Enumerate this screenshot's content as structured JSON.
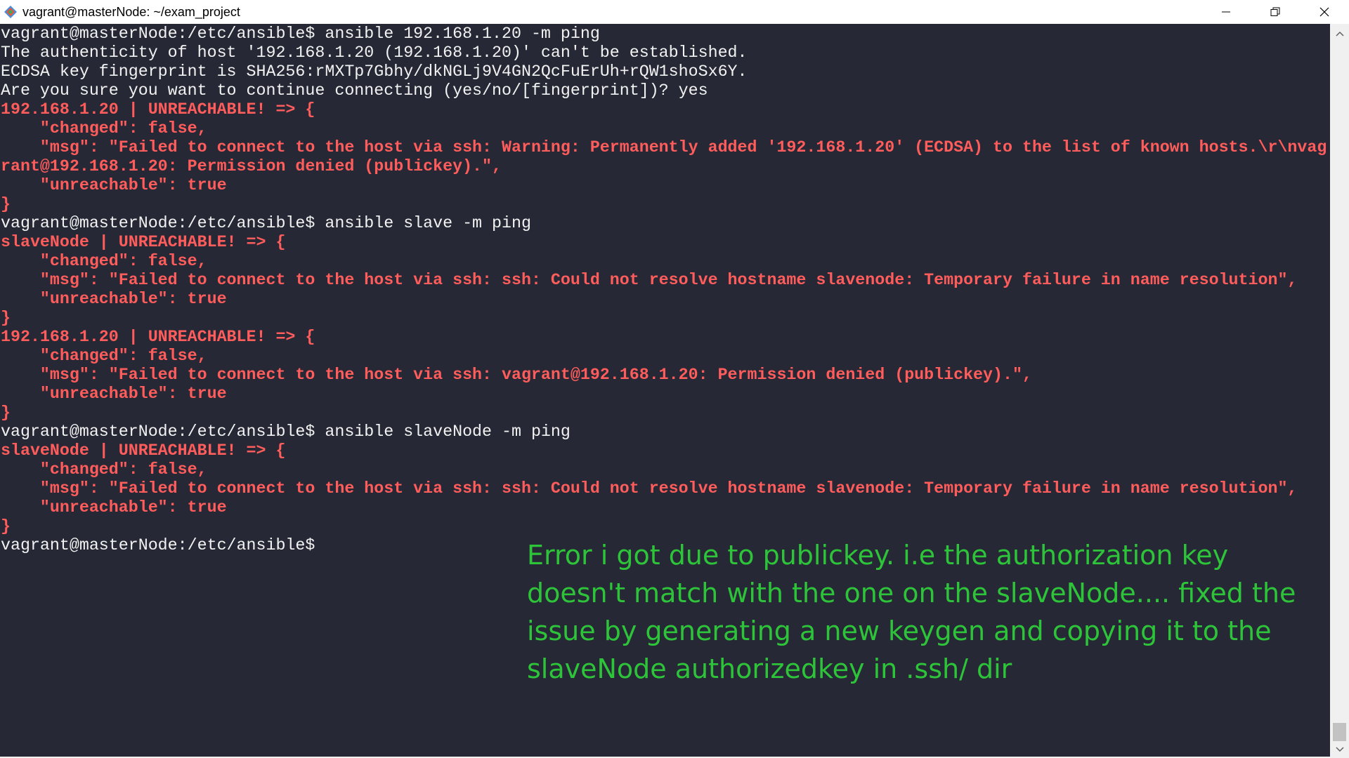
{
  "window": {
    "title": "vagrant@masterNode: ~/exam_project",
    "icon": "git-bash-icon",
    "controls": [
      "minimize-icon",
      "restore-icon",
      "close-icon"
    ]
  },
  "terminal": {
    "lines": [
      {
        "text": "vagrant@masterNode:/etc/ansible$ ansible 192.168.1.20 -m ping",
        "color": "white"
      },
      {
        "text": "The authenticity of host '192.168.1.20 (192.168.1.20)' can't be established.",
        "color": "white"
      },
      {
        "text": "ECDSA key fingerprint is SHA256:rMXTp7Gbhy/dkNGLj9V4GN2QcFuErUh+rQW1shoSx6Y.",
        "color": "white"
      },
      {
        "text": "Are you sure you want to continue connecting (yes/no/[fingerprint])? yes",
        "color": "white"
      },
      {
        "text": "192.168.1.20 | UNREACHABLE! => {",
        "color": "red"
      },
      {
        "text": "    \"changed\": false,",
        "color": "red"
      },
      {
        "text": "    \"msg\": \"Failed to connect to the host via ssh: Warning: Permanently added '192.168.1.20' (ECDSA) to the list of known hosts.\\r\\nvag",
        "color": "red"
      },
      {
        "text": "rant@192.168.1.20: Permission denied (publickey).\",",
        "color": "red"
      },
      {
        "text": "    \"unreachable\": true",
        "color": "red"
      },
      {
        "text": "}",
        "color": "red"
      },
      {
        "text": "vagrant@masterNode:/etc/ansible$ ansible slave -m ping",
        "color": "white"
      },
      {
        "text": "slaveNode | UNREACHABLE! => {",
        "color": "red"
      },
      {
        "text": "    \"changed\": false,",
        "color": "red"
      },
      {
        "text": "    \"msg\": \"Failed to connect to the host via ssh: ssh: Could not resolve hostname slavenode: Temporary failure in name resolution\",",
        "color": "red"
      },
      {
        "text": "    \"unreachable\": true",
        "color": "red"
      },
      {
        "text": "}",
        "color": "red"
      },
      {
        "text": "192.168.1.20 | UNREACHABLE! => {",
        "color": "red"
      },
      {
        "text": "    \"changed\": false,",
        "color": "red"
      },
      {
        "text": "    \"msg\": \"Failed to connect to the host via ssh: vagrant@192.168.1.20: Permission denied (publickey).\",",
        "color": "red"
      },
      {
        "text": "    \"unreachable\": true",
        "color": "red"
      },
      {
        "text": "}",
        "color": "red"
      },
      {
        "text": "vagrant@masterNode:/etc/ansible$ ansible slaveNode -m ping",
        "color": "white"
      },
      {
        "text": "slaveNode | UNREACHABLE! => {",
        "color": "red"
      },
      {
        "text": "    \"changed\": false,",
        "color": "red"
      },
      {
        "text": "    \"msg\": \"Failed to connect to the host via ssh: ssh: Could not resolve hostname slavenode: Temporary failure in name resolution\",",
        "color": "red"
      },
      {
        "text": "    \"unreachable\": true",
        "color": "red"
      },
      {
        "text": "}",
        "color": "red"
      },
      {
        "text": "vagrant@masterNode:/etc/ansible$",
        "color": "white"
      }
    ]
  },
  "annotation": {
    "text": "Error i got due to publickey. i.e the authorization key doesn't match with the one on the slaveNode.... fixed the issue by generating a new keygen and copying it to the slaveNode authorizedkey in .ssh/ dir"
  },
  "colors": {
    "background": "#262935",
    "text": "#f2f2f2",
    "error": "#ff5c5c",
    "annotation": "#2ec43a"
  }
}
